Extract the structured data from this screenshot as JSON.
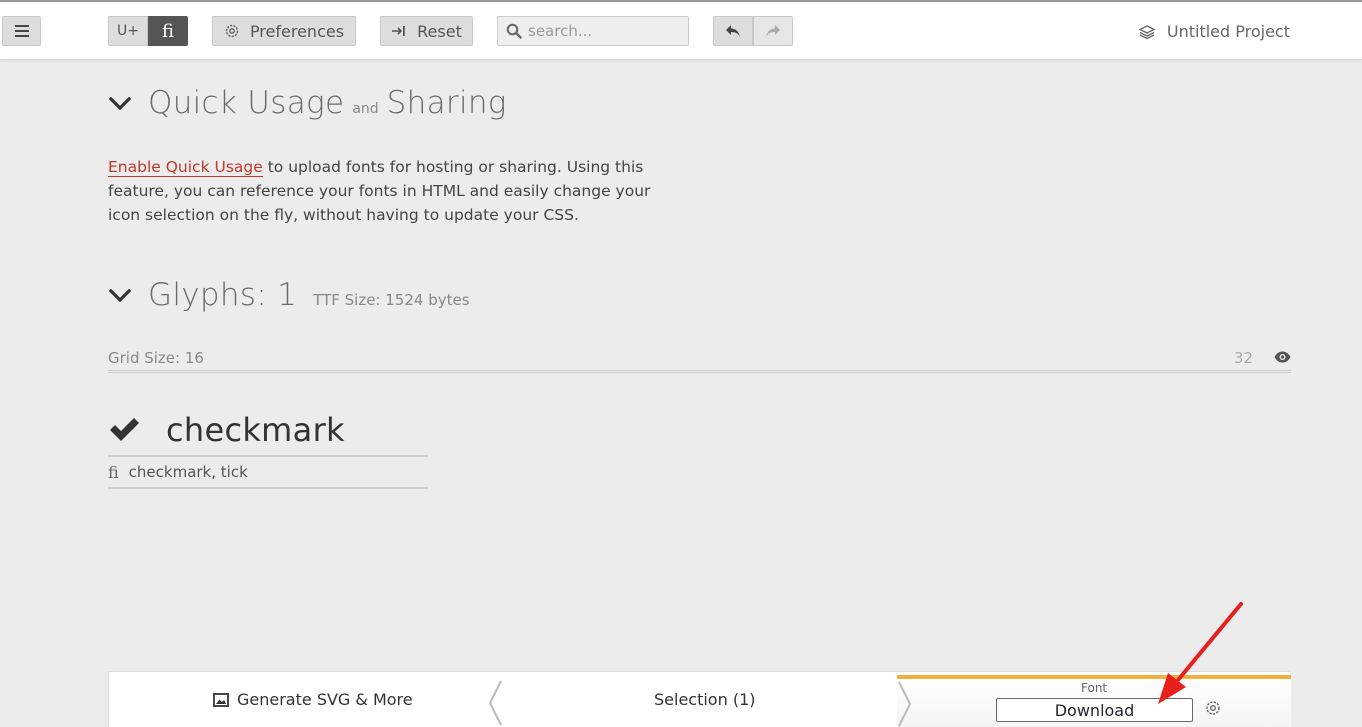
{
  "toolbar": {
    "menu_icon": "hamburger-icon",
    "unicode_label": "U+",
    "ligature_label": "fi",
    "preferences_label": "Preferences",
    "reset_label": "Reset",
    "search_placeholder": "search...",
    "project_name": "Untitled Project"
  },
  "quick_usage": {
    "title_a": "Quick Usage",
    "title_and": "and",
    "title_b": "Sharing",
    "link_text": "Enable Quick Usage",
    "body_text": " to upload fonts for hosting or sharing. Using this feature, you can reference your fonts in HTML and easily change your icon selection on the fly, without having to update your CSS."
  },
  "glyphs": {
    "title": "Glyphs: 1",
    "ttf_size": "TTF Size: 1524 bytes",
    "grid_size": "Grid Size: 16",
    "preview_size": "32",
    "items": [
      {
        "name": "checkmark",
        "tags": "checkmark, tick",
        "tag_prefix": "fi"
      }
    ]
  },
  "bottombar": {
    "generate_label": "Generate SVG & More",
    "selection_label": "Selection (1)",
    "font_label": "Font",
    "download_label": "Download"
  },
  "colors": {
    "accent_link": "#c0392b",
    "font_panel_accent": "#f0b040",
    "annotation_arrow": "#e8201c"
  }
}
